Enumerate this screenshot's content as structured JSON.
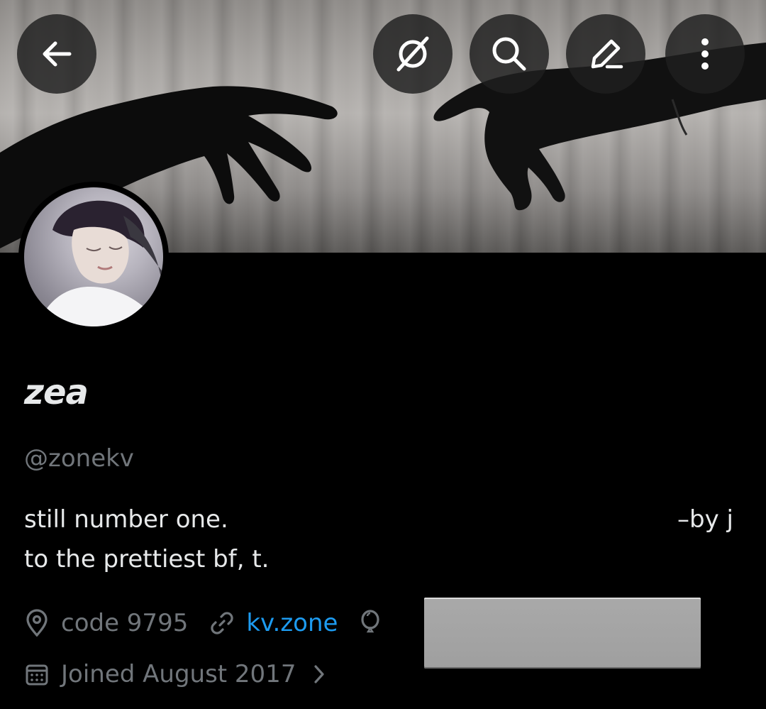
{
  "header": {
    "back_icon": "arrow-left-icon",
    "grok_icon": "grok-icon",
    "search_icon": "search-icon",
    "edit_icon": "pencil-icon",
    "more_icon": "more-vertical-icon"
  },
  "profile": {
    "display_name": "zea",
    "handle": "@zonekv",
    "bio_line1": "still number one.",
    "bio_right": "–by j",
    "bio_line2": "to the prettiest bf, t.",
    "location": "code 9795",
    "website": "kv.zone",
    "joined": "Joined August 2017"
  },
  "colors": {
    "background": "#000000",
    "text": "#e7e9ea",
    "muted": "#71767b",
    "link": "#1d9bf0"
  }
}
